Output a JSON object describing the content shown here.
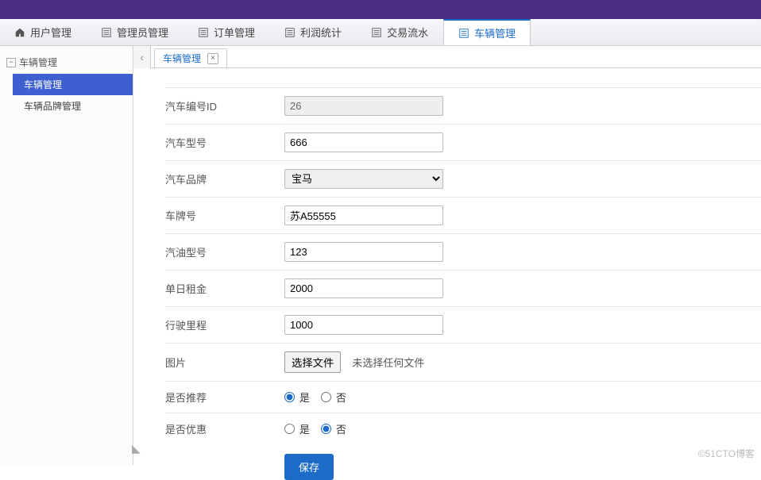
{
  "nav": [
    {
      "label": "用户管理",
      "icon": "home"
    },
    {
      "label": "管理员管理",
      "icon": "list"
    },
    {
      "label": "订单管理",
      "icon": "list"
    },
    {
      "label": "利润统计",
      "icon": "list"
    },
    {
      "label": "交易流水",
      "icon": "list"
    },
    {
      "label": "车辆管理",
      "icon": "list",
      "active": true
    }
  ],
  "sidebar": {
    "root_label": "车辆管理",
    "items": [
      {
        "label": "车辆管理",
        "selected": true
      },
      {
        "label": "车辆品牌管理",
        "selected": false
      }
    ]
  },
  "tab": {
    "label": "车辆管理"
  },
  "form": {
    "id_label": "汽车编号ID",
    "id_value": "26",
    "model_label": "汽车型号",
    "model_value": "666",
    "brand_label": "汽车品牌",
    "brand_value": "宝马",
    "plate_label": "车牌号",
    "plate_value": "苏A55555",
    "gas_label": "汽油型号",
    "gas_value": "123",
    "rent_label": "单日租金",
    "rent_value": "2000",
    "mileage_label": "行驶里程",
    "mileage_value": "1000",
    "pic_label": "图片",
    "file_btn": "选择文件",
    "file_text": "未选择任何文件",
    "rec_label": "是否推荐",
    "yes": "是",
    "no": "否",
    "rec_value": "yes",
    "disc_label": "是否优惠",
    "disc_value": "no",
    "save": "保存"
  },
  "watermark": "©51CTO博客"
}
